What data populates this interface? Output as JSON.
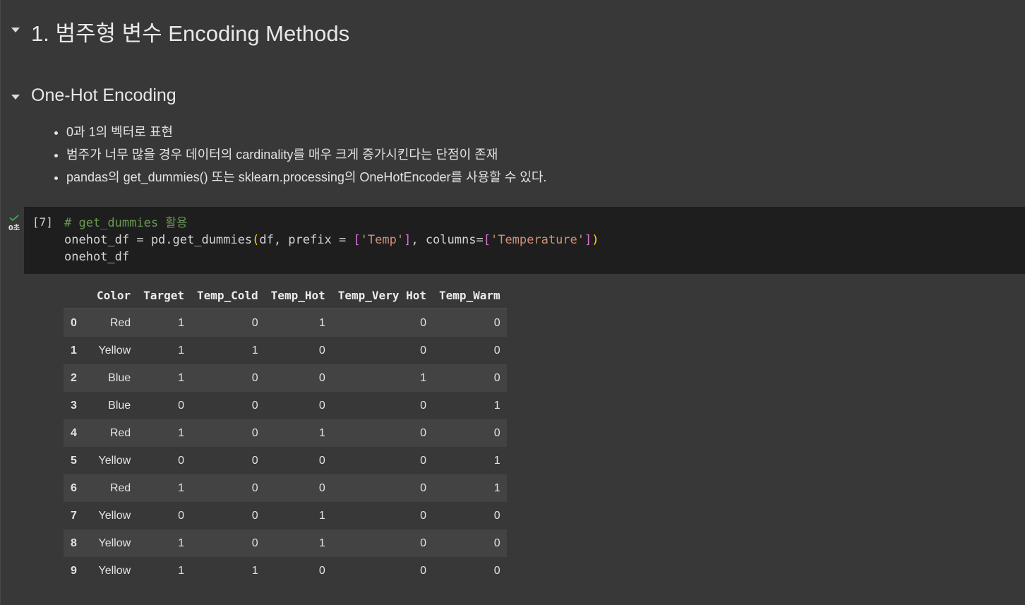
{
  "section1": {
    "title": "1. 범주형 변수 Encoding Methods"
  },
  "section2": {
    "title": "One-Hot Encoding",
    "bullets": [
      "0과 1의 벡터로 표현",
      "범주가 너무 많을 경우 데이터의 cardinality를 매우 크게 증가시킨다는 단점이 존재",
      "pandas의 get_dummies() 또는 sklearn.processing의 OneHotEncoder를 사용할 수 있다."
    ]
  },
  "cell": {
    "exec_count": "[7]",
    "run_time": "0초",
    "code": {
      "comment": "# get_dummies 활용",
      "l2_a": "onehot_df = pd.get_dummies",
      "l2_paren_open": "(",
      "l2_b": "df, prefix = ",
      "l2_br1_open": "[",
      "l2_str1": "'Temp'",
      "l2_br1_close": "]",
      "l2_c": ", columns=",
      "l2_br2_open": "[",
      "l2_str2": "'Temperature'",
      "l2_br2_close": "]",
      "l2_paren_close": ")",
      "line3": "onehot_df"
    }
  },
  "output_table": {
    "columns": [
      "",
      "Color",
      "Target",
      "Temp_Cold",
      "Temp_Hot",
      "Temp_Very Hot",
      "Temp_Warm"
    ],
    "rows": [
      [
        "0",
        "Red",
        "1",
        "0",
        "1",
        "0",
        "0"
      ],
      [
        "1",
        "Yellow",
        "1",
        "1",
        "0",
        "0",
        "0"
      ],
      [
        "2",
        "Blue",
        "1",
        "0",
        "0",
        "1",
        "0"
      ],
      [
        "3",
        "Blue",
        "0",
        "0",
        "0",
        "0",
        "1"
      ],
      [
        "4",
        "Red",
        "1",
        "0",
        "1",
        "0",
        "0"
      ],
      [
        "5",
        "Yellow",
        "0",
        "0",
        "0",
        "0",
        "1"
      ],
      [
        "6",
        "Red",
        "1",
        "0",
        "0",
        "0",
        "1"
      ],
      [
        "7",
        "Yellow",
        "0",
        "0",
        "1",
        "0",
        "0"
      ],
      [
        "8",
        "Yellow",
        "1",
        "0",
        "1",
        "0",
        "0"
      ],
      [
        "9",
        "Yellow",
        "1",
        "1",
        "0",
        "0",
        "0"
      ]
    ]
  },
  "icons": {
    "collapse": "chevron-down-icon",
    "status": "check-icon"
  },
  "colors": {
    "background": "#383838",
    "code_background": "#1e1e1e",
    "comment": "#6a9955",
    "string": "#ce9178",
    "check": "#4caf50"
  }
}
